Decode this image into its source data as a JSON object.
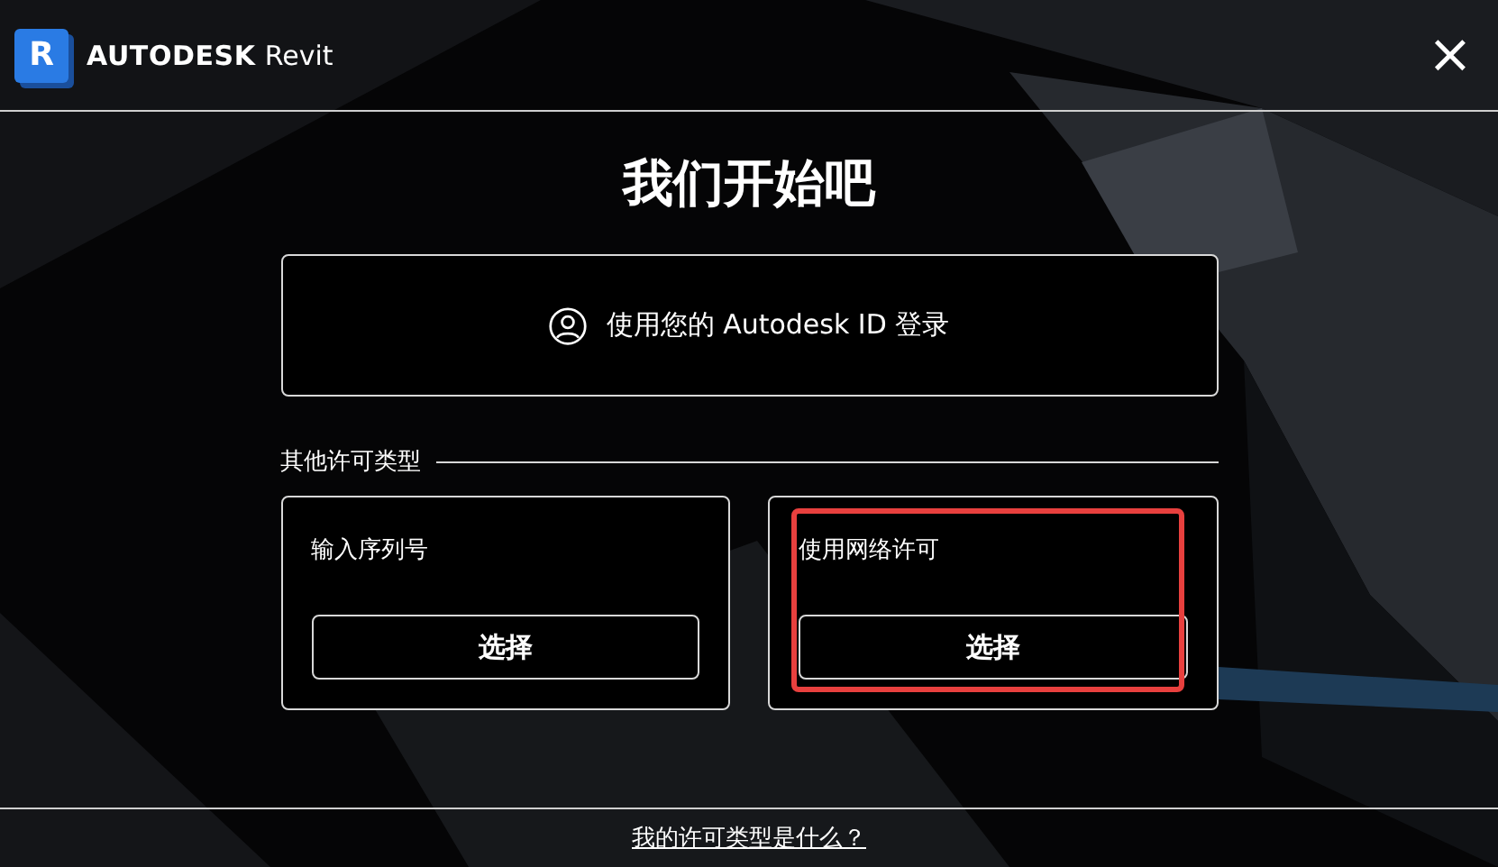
{
  "header": {
    "logo_letter": "R",
    "brand": "AUTODESK",
    "product": "Revit",
    "close": "×"
  },
  "title": "我们开始吧",
  "sign_in": {
    "label": "使用您的 Autodesk ID 登录"
  },
  "other_section": {
    "label": "其他许可类型"
  },
  "options": [
    {
      "label": "输入序列号",
      "button": "选择",
      "highlighted": false
    },
    {
      "label": "使用网络许可",
      "button": "选择",
      "highlighted": true
    }
  ],
  "help_link": "我的许可类型是什么？"
}
